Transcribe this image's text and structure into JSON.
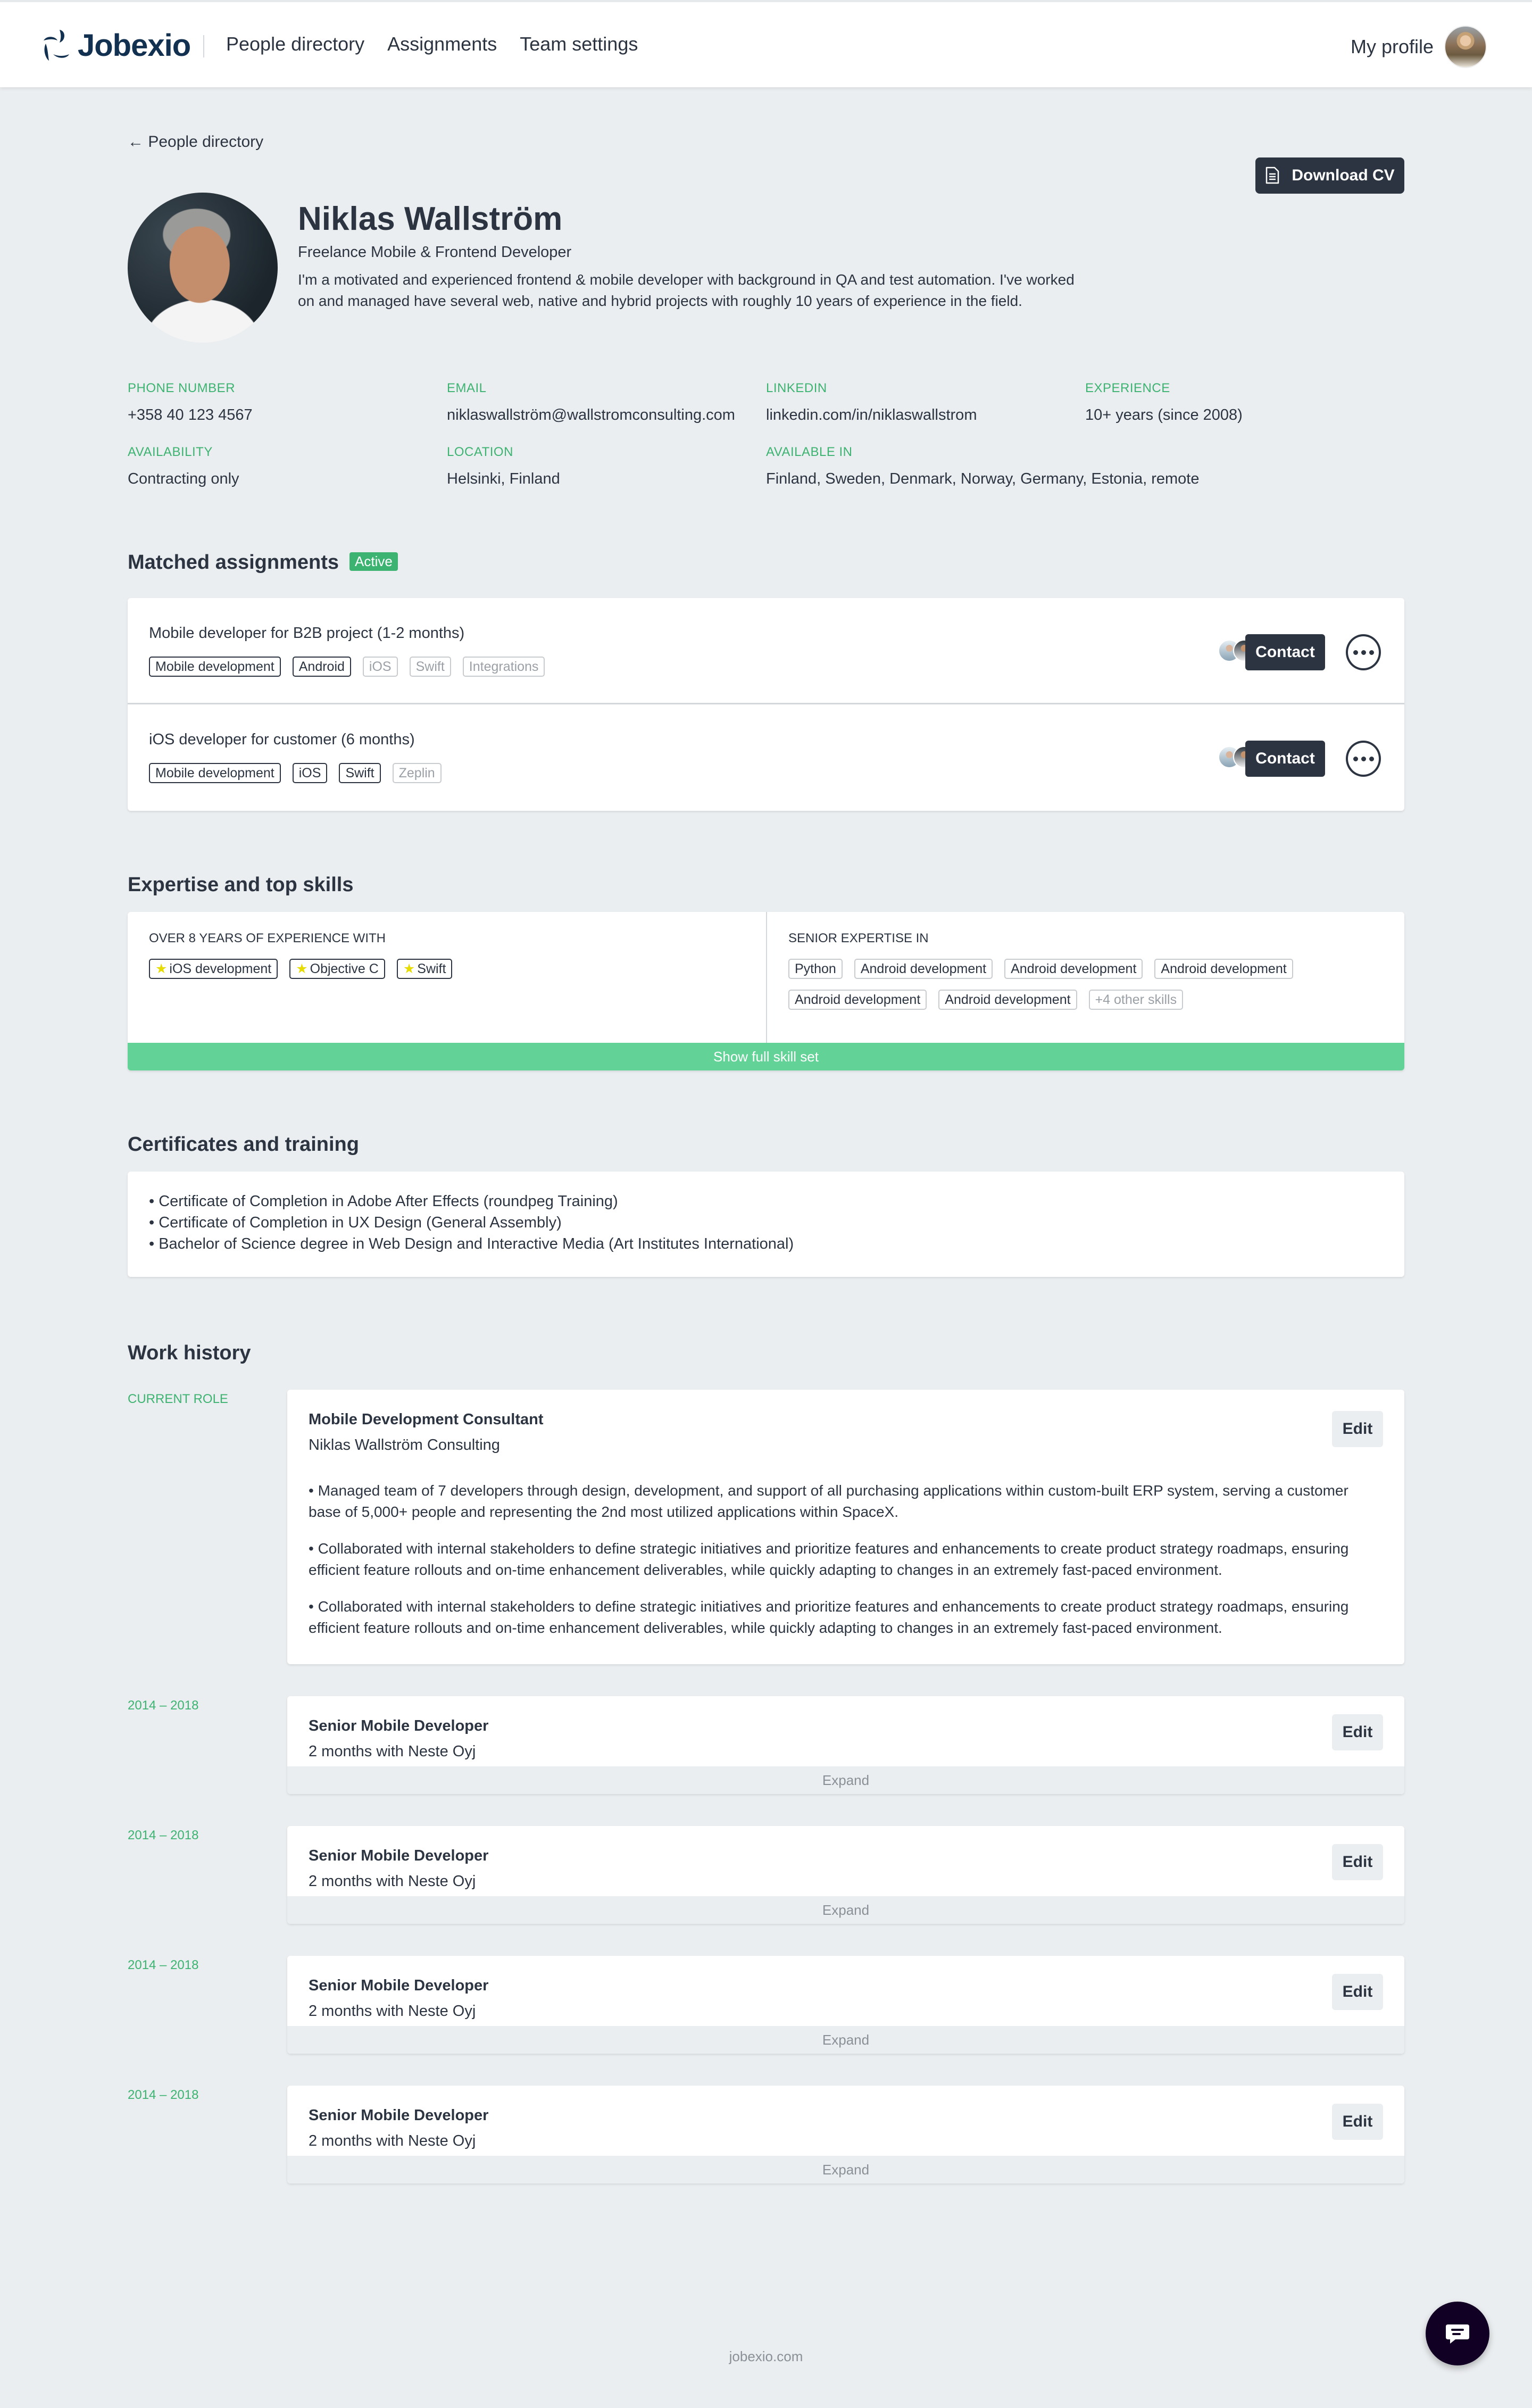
{
  "nav": {
    "brand": "Jobexio",
    "links": [
      "People directory",
      "Assignments",
      "Team settings"
    ],
    "my_profile": "My profile"
  },
  "back_link": "← People directory",
  "download_cv": "Download CV",
  "profile": {
    "name": "Niklas Wallström",
    "title": "Freelance Mobile & Frontend Developer",
    "bio": "I'm a motivated and experienced frontend & mobile developer with background in QA and test automation. I've worked on and managed have several web, native and hybrid projects with roughly 10 years of experience in the field."
  },
  "info": [
    {
      "label": "Phone number",
      "value": "+358 40 123 4567"
    },
    {
      "label": "Email",
      "value": "niklaswallström@wallstromconsulting.com"
    },
    {
      "label": "LinkedIn",
      "value": "linkedin.com/in/niklaswallstrom"
    },
    {
      "label": "Experience",
      "value": "10+ years (since 2008)"
    },
    {
      "label": "Availability",
      "value": "Contracting only"
    },
    {
      "label": "Location",
      "value": "Helsinki, Finland"
    },
    {
      "label": "Available in",
      "value": "Finland, Sweden, Denmark, Norway, Germany, Estonia, remote"
    }
  ],
  "assignments": {
    "title": "Matched assignments",
    "badge": "Active",
    "contact_label": "Contact",
    "items": [
      {
        "title": "Mobile developer for B2B project (1-2 months)",
        "tags": [
          {
            "label": "Mobile development",
            "matched": true
          },
          {
            "label": "Android",
            "matched": true
          },
          {
            "label": "iOS",
            "matched": false
          },
          {
            "label": "Swift",
            "matched": false
          },
          {
            "label": "Integrations",
            "matched": false
          }
        ]
      },
      {
        "title": "iOS developer for customer (6 months)",
        "tags": [
          {
            "label": "Mobile development",
            "matched": true
          },
          {
            "label": "iOS",
            "matched": true
          },
          {
            "label": "Swift",
            "matched": true
          },
          {
            "label": "Zeplin",
            "matched": false
          }
        ]
      }
    ]
  },
  "skills": {
    "title": "Expertise and top skills",
    "left_heading": "Over 8 years of experience with",
    "left_tags": [
      "iOS development",
      "Objective C",
      "Swift"
    ],
    "right_heading": "Senior expertise in",
    "right_tags": [
      "Python",
      "Android development",
      "Android development",
      "Android development",
      "Android development",
      "Android development"
    ],
    "more": "+4 other skills",
    "show_full": "Show full skill set"
  },
  "certificates": {
    "title": "Certificates and training",
    "items": [
      "• Certificate of Completion in Adobe After Effects (roundpeg Training)",
      "• Certificate of Completion in UX Design (General Assembly)",
      "• Bachelor of Science degree in Web Design and Interactive Media (Art Institutes International)"
    ]
  },
  "work": {
    "title": "Work history",
    "edit_label": "Edit",
    "expand_label": "Expand",
    "current": {
      "period": "Current role",
      "role": "Mobile Development Consultant",
      "company": "Niklas Wallström Consulting",
      "bullets": [
        "• Managed team of 7 developers through design, development, and support of all purchasing applications within custom-built ERP system, serving a customer base of 5,000+ people and representing the 2nd most utilized applications within SpaceX.",
        "• Collaborated with internal stakeholders to define strategic initiatives and prioritize features and enhancements to create product strategy roadmaps, ensuring efficient feature rollouts and on-time enhancement deliverables, while quickly adapting to changes in an extremely fast-paced environment.",
        "• Collaborated with internal stakeholders to define strategic initiatives and prioritize features and enhancements to create product strategy roadmaps, ensuring efficient feature rollouts and on-time enhancement deliverables, while quickly adapting to changes in an extremely fast-paced environment."
      ]
    },
    "past": [
      {
        "period": "2014 – 2018",
        "role": "Senior Mobile Developer",
        "company": "2 months with Neste Oyj"
      },
      {
        "period": "2014 – 2018",
        "role": "Senior Mobile Developer",
        "company": "2 months with Neste Oyj"
      },
      {
        "period": "2014 – 2018",
        "role": "Senior Mobile Developer",
        "company": "2 months with Neste Oyj"
      },
      {
        "period": "2014 – 2018",
        "role": "Senior Mobile Developer",
        "company": "2 months with Neste Oyj"
      }
    ]
  },
  "footer": "jobexio.com",
  "colors": {
    "accent_green": "#3cb371",
    "skills_bar": "#62d296",
    "dark": "#2b3440",
    "brand": "#12304f",
    "star": "#e6dc00",
    "chat": "#120024"
  }
}
